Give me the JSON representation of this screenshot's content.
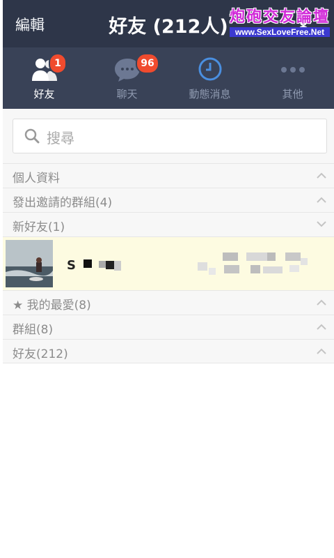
{
  "header": {
    "edit_label": "編輯",
    "title": "好友 (212人)"
  },
  "watermark": {
    "line1": "炮砲交友論壇",
    "line2": "www.SexLoveFree.Net"
  },
  "tabs": [
    {
      "label": "好友",
      "icon": "friends-icon",
      "badge": "1",
      "active": true
    },
    {
      "label": "聊天",
      "icon": "chat-bubble-icon",
      "badge": "96",
      "active": false
    },
    {
      "label": "動態消息",
      "icon": "clock-icon",
      "badge": "",
      "active": false
    },
    {
      "label": "其他",
      "icon": "more-dots-icon",
      "badge": "",
      "active": false
    }
  ],
  "search": {
    "placeholder": "搜尋"
  },
  "sections": {
    "profile": "個人資料",
    "sent_invites": "發出邀請的群組(4)",
    "new_friends": "新好友(1)",
    "favorites": "我的最愛(8)",
    "groups": "群組(8)",
    "friends": "好友(212)"
  },
  "new_friend": {
    "name_initial": "S"
  },
  "colors": {
    "header_bg": "#2e3649",
    "tab_bg": "#394257",
    "badge": "#f04b2e",
    "highlight_row": "#fdfbe1",
    "clock_blue": "#4a8fe0"
  }
}
